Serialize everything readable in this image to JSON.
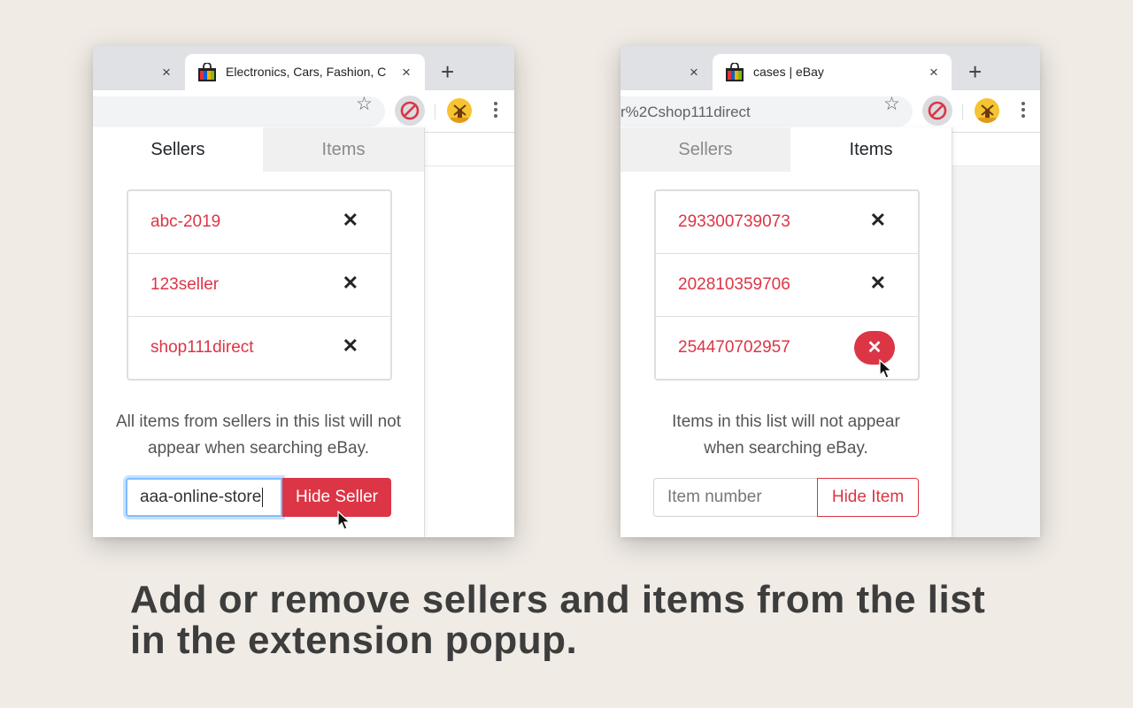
{
  "left_window": {
    "active_tab_title": "Electronics, Cars, Fashion, C",
    "close_icon": "×",
    "newtab_icon": "+",
    "star_icon": "☆",
    "popup": {
      "tabs": [
        "Sellers",
        "Items"
      ],
      "selected_tab": "Sellers",
      "list": [
        {
          "label": "abc-2019",
          "remove": "✕"
        },
        {
          "label": "123seller",
          "remove": "✕"
        },
        {
          "label": "shop111direct",
          "remove": "✕"
        }
      ],
      "description": "All items from sellers in this list will not appear when searching eBay.",
      "input_value": "aaa-online-store",
      "button_label": "Hide Seller"
    }
  },
  "right_window": {
    "active_tab_title": "cases | eBay",
    "close_icon": "×",
    "newtab_icon": "+",
    "star_icon": "☆",
    "omnibox_text": "r%2Cshop111direct",
    "popup": {
      "tabs": [
        "Sellers",
        "Items"
      ],
      "selected_tab": "Items",
      "list": [
        {
          "label": "293300739073",
          "remove": "✕"
        },
        {
          "label": "202810359706",
          "remove": "✕"
        },
        {
          "label": "254470702957",
          "remove": "✕"
        }
      ],
      "description": "Items in this list will not appear when searching eBay.",
      "input_placeholder": "Item number",
      "button_label": "Hide Item"
    }
  },
  "caption": {
    "line1": "Add or remove sellers and items from the list",
    "line2": "in the extension popup."
  },
  "colors": {
    "background": "#f0ebe5",
    "accent_red": "#dc3545",
    "focus_blue": "#80bdff",
    "caption_text": "#3d3d3d"
  },
  "icons": {
    "favicon": "shopping-bag-icon",
    "extension": "blocked-sign-icon",
    "avatar": "windmill-avatar-icon",
    "menu": "kebab-menu-icon",
    "cursor": "mouse-pointer-icon"
  }
}
